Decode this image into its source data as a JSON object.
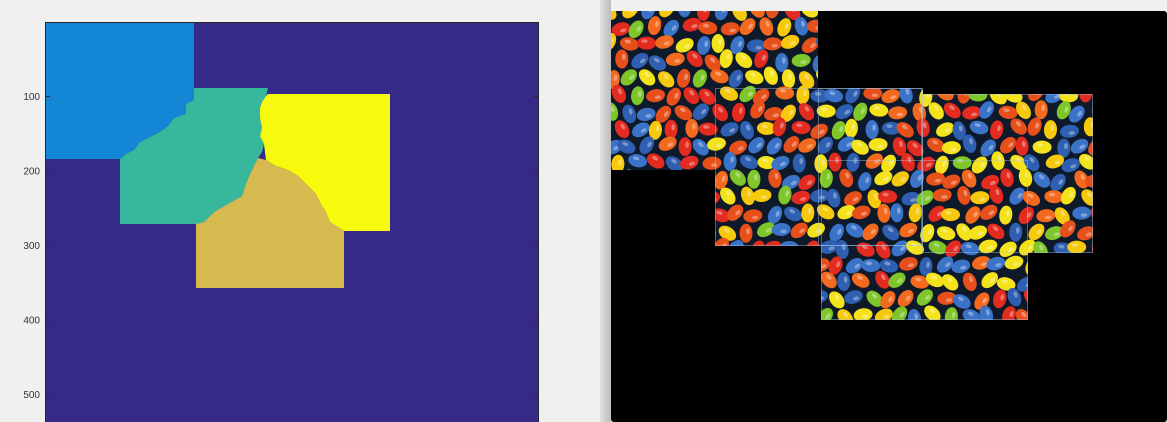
{
  "figure_left": {
    "y_ticks": [
      {
        "value": 100,
        "label": "100"
      },
      {
        "value": 200,
        "label": "200"
      },
      {
        "value": 300,
        "label": "300"
      },
      {
        "value": 400,
        "label": "400"
      },
      {
        "value": 500,
        "label": "500"
      }
    ],
    "y_range": [
      0,
      532
    ],
    "colors": {
      "background_label": "#352a87",
      "region_blue": "#1387d5",
      "region_teal": "#37b89d",
      "region_yellow": "#f8fa0d",
      "region_gold": "#d7ba4f",
      "axes_frame": "#262626",
      "figure_bg": "#f0f0f0"
    }
  },
  "figure_right": {
    "colors": {
      "canvas_bg": "#000000",
      "tile_border": "#a9c8e8",
      "candy_palette": [
        "#e32b1f",
        "#f36a1e",
        "#f7c90c",
        "#f4e21b",
        "#7fc62a",
        "#3a73c8",
        "#2e5fb0",
        "#e8501b"
      ]
    }
  }
}
